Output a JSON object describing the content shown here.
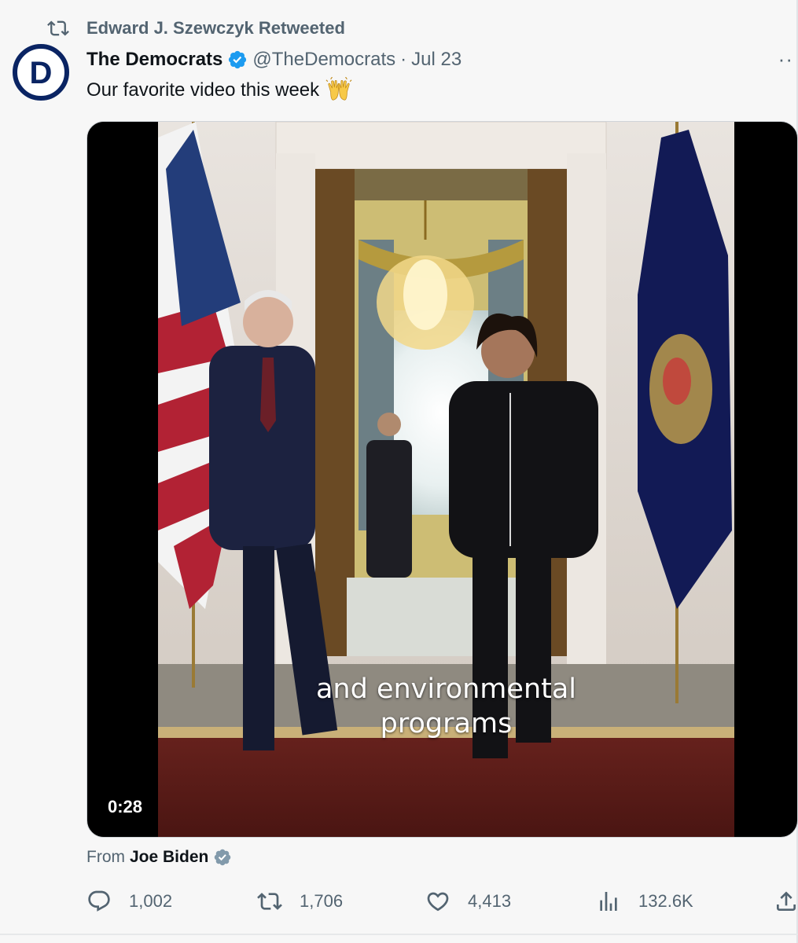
{
  "retweet_banner": {
    "text": "Edward J. Szewczyk Retweeted"
  },
  "tweet": {
    "author_name": "The Democrats",
    "author_handle": "@TheDemocrats",
    "separator": "·",
    "date": "Jul 23",
    "avatar_letter": "D",
    "text": "Our favorite video this week",
    "emoji": "raised-hands-emoji",
    "more_label": "··"
  },
  "video": {
    "caption_line1": "and environmental",
    "caption_line2": "programs",
    "duration": "0:28"
  },
  "attribution": {
    "from_label": "From",
    "from_name": "Joe Biden"
  },
  "actions": {
    "replies": "1,002",
    "retweets": "1,706",
    "likes": "4,413",
    "views": "132.6K"
  },
  "colors": {
    "brand_blue": "#1d9bf0",
    "dem_navy": "#0a2463",
    "muted_text": "#536471",
    "verified_grey": "#829aab"
  }
}
